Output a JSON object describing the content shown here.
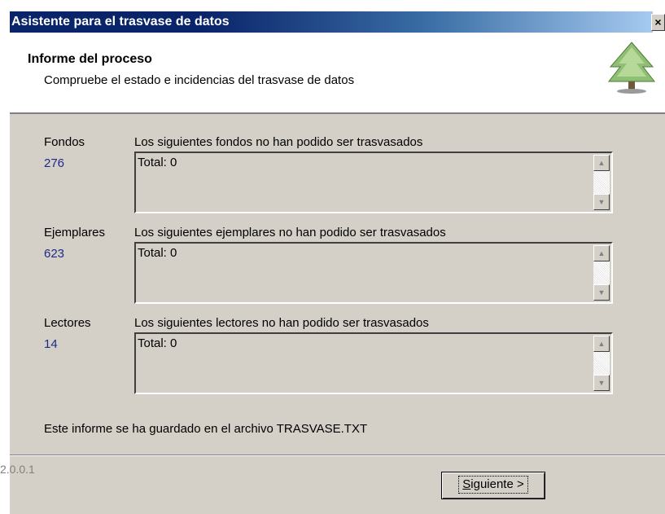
{
  "window": {
    "title": "Asistente para el trasvase de datos",
    "close_label": "×"
  },
  "header": {
    "title": "Informe del proceso",
    "subtitle": "Compruebe el estado e incidencias del trasvase de datos",
    "icon": "tree-icon"
  },
  "categories": [
    {
      "name": "Fondos",
      "count": "276",
      "description": "Los siguientes fondos no han podido ser trasvasados",
      "list_text": "Total: 0"
    },
    {
      "name": "Ejemplares",
      "count": "623",
      "description": "Los siguientes ejemplares no han podido ser trasvasados",
      "list_text": "Total: 0"
    },
    {
      "name": "Lectores",
      "count": "14",
      "description": "Los siguientes lectores no han podido ser trasvasados",
      "list_text": "Total: 0"
    }
  ],
  "saved_note": "Este informe se ha guardado en el archivo TRASVASE.TXT",
  "footer": {
    "version": "2.0.0.1",
    "next_button": {
      "accel": "S",
      "rest": "iguiente >"
    }
  },
  "colors": {
    "title_bar": "#0a246a",
    "count_text": "#1c2a8a",
    "dialog_face": "#d4d0c8"
  }
}
